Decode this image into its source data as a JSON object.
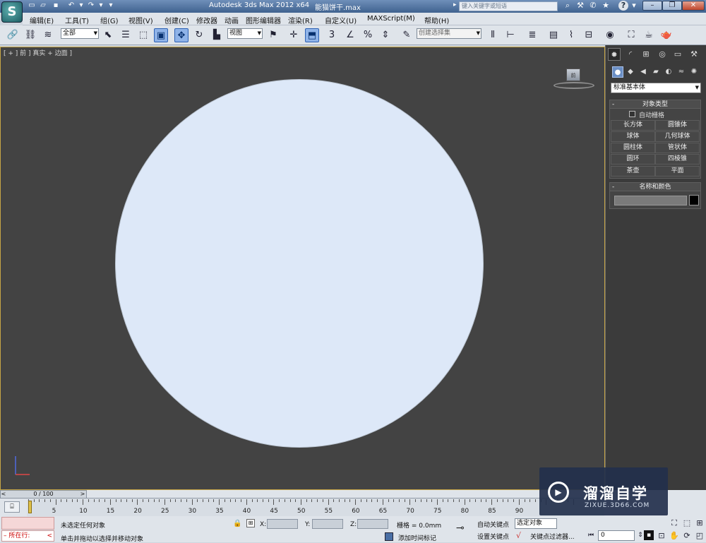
{
  "titlebar": {
    "app_title": "Autodesk 3ds Max  2012 x64",
    "file_name": "能猫饼干.max",
    "search_placeholder": "键入关键字或短语",
    "help_icon": "?"
  },
  "menus": [
    "编辑(E)",
    "工具(T)",
    "组(G)",
    "视图(V)",
    "创建(C)",
    "修改器",
    "动画",
    "图形编辑器",
    "渲染(R)",
    "自定义(U)",
    "MAXScript(M)",
    "帮助(H)"
  ],
  "toolbar": {
    "filter": "全部",
    "ref_coord": "视图",
    "snap_label": "3",
    "named_selection": "创建选择集"
  },
  "viewport": {
    "label": "[ + ] 前 ] 真实 + 边面 ]",
    "viewcube_label": "前",
    "object_color": "#dde8f8",
    "background_color": "#434343"
  },
  "command_panel": {
    "category": "标准基本体",
    "object_type": {
      "title": "对象类型",
      "autogrid": "自动栅格",
      "buttons": [
        "长方体",
        "圆锥体",
        "球体",
        "几何球体",
        "圆柱体",
        "管状体",
        "圆环",
        "四棱锥",
        "茶壶",
        "平面"
      ]
    },
    "name_color": {
      "title": "名称和颜色",
      "name_value": "",
      "color": "#000000"
    }
  },
  "timeline": {
    "slider_label": "0 / 100",
    "ticks": [
      "0",
      "5",
      "10",
      "15",
      "20",
      "25",
      "30",
      "35",
      "40",
      "45",
      "50",
      "55",
      "60",
      "65",
      "70",
      "75",
      "80",
      "85",
      "90"
    ]
  },
  "status": {
    "running": "所在行:",
    "selection": "未选定任何对象",
    "prompt": "单击并拖动以选择并移动对象",
    "x_label": "X:",
    "y_label": "Y:",
    "z_label": "Z:",
    "grid": "栅格 = 0.0mm",
    "add_time_tag": "添加时间标记",
    "auto_key": "自动关键点",
    "set_key": "设置关键点",
    "selected_dd": "选定对象",
    "key_filters": "关键点过滤器...",
    "frame": "0"
  },
  "watermark": {
    "title": "溜溜自学",
    "url": "ZIXUE.3D66.COM"
  }
}
